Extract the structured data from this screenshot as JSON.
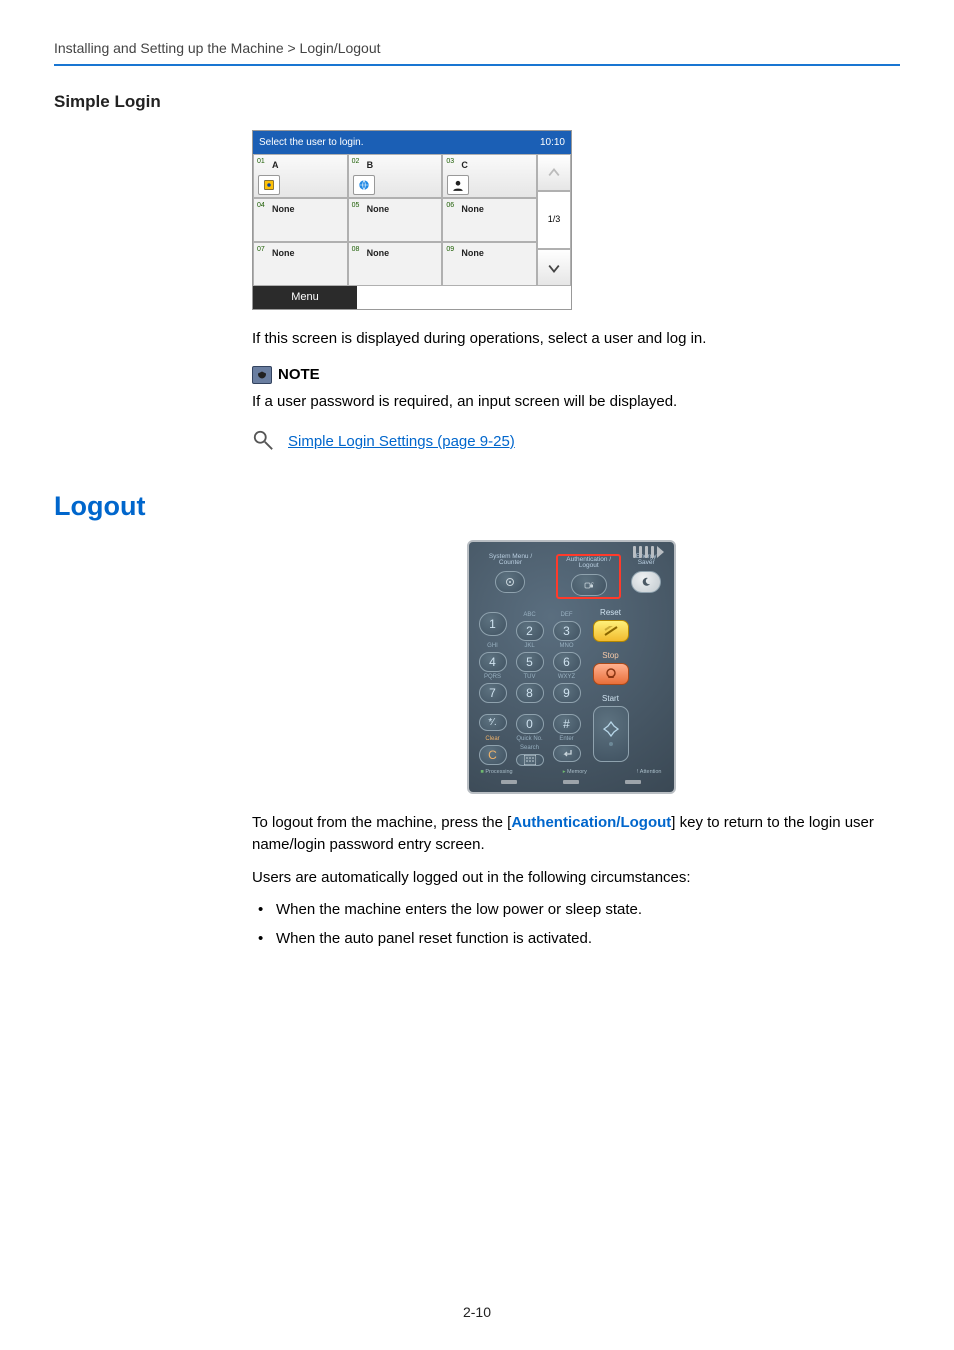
{
  "breadcrumb": "Installing and Setting up the Machine > Login/Logout",
  "simple_login": {
    "heading": "Simple Login",
    "panel": {
      "prompt": "Select the user to login.",
      "time": "10:10",
      "tiles": [
        {
          "num": "01",
          "label": "A",
          "icon": "admin"
        },
        {
          "num": "02",
          "label": "B",
          "icon": "user-globe"
        },
        {
          "num": "03",
          "label": "C",
          "icon": "user"
        },
        {
          "num": "04",
          "label": "None"
        },
        {
          "num": "05",
          "label": "None"
        },
        {
          "num": "06",
          "label": "None"
        },
        {
          "num": "07",
          "label": "None"
        },
        {
          "num": "08",
          "label": "None"
        },
        {
          "num": "09",
          "label": "None"
        }
      ],
      "page_indicator": "1/3",
      "menu_label": "Menu"
    },
    "caption": "If this screen is displayed during operations, select a user and log in.",
    "note_label": "NOTE",
    "note_body": "If a user password is required, an input screen will be displayed.",
    "link": "Simple Login Settings (page 9-25)"
  },
  "logout": {
    "heading": "Logout",
    "keypad": {
      "top": {
        "sysmenu": "System Menu /\nCounter",
        "auth": "Authentication /\nLogout",
        "energy": "Energy Saver"
      },
      "subs": {
        "1": "",
        "2": "ABC",
        "3": "DEF",
        "4": "GHI",
        "5": "JKL",
        "6": "MNO",
        "7": "PQRS",
        "8": "TUV",
        "9": "WXYZ"
      },
      "bottom_left": "Clear",
      "bottom_mid": "Quick No.\nSearch",
      "bottom_right": "Enter",
      "reset": "Reset",
      "stop": "Stop",
      "start": "Start",
      "footer_processing": "Processing",
      "footer_memory": "Memory",
      "footer_attention": "! Attention"
    },
    "para1_a": "To logout from the machine, press the [",
    "para1_hl": "Authentication/Logout",
    "para1_b": "] key to return to the login user name/login password entry screen.",
    "para2": "Users are automatically logged out in the following circumstances:",
    "bullets": [
      "When the machine enters the low power or sleep state.",
      "When the auto panel reset function is activated."
    ]
  },
  "page_number": "2-10"
}
